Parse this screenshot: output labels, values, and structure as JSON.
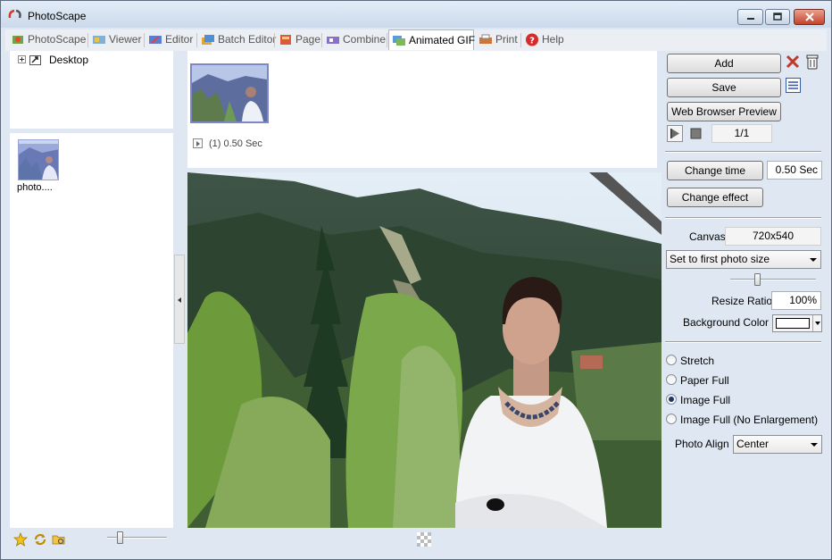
{
  "window": {
    "title": "PhotoScape"
  },
  "tabs": [
    {
      "label": "PhotoScape",
      "icon": "photoscape-icon",
      "active": false
    },
    {
      "label": "Viewer",
      "icon": "viewer-icon",
      "active": false
    },
    {
      "label": "Editor",
      "icon": "editor-icon",
      "active": false
    },
    {
      "label": "Batch Editor",
      "icon": "batch-editor-icon",
      "active": false
    },
    {
      "label": "Page",
      "icon": "page-icon",
      "active": false
    },
    {
      "label": "Combine",
      "icon": "combine-icon",
      "active": false
    },
    {
      "label": "Animated GIF",
      "icon": "animated-gif-icon",
      "active": true
    },
    {
      "label": "Print",
      "icon": "print-icon",
      "active": false
    },
    {
      "label": "Help",
      "icon": "help-icon",
      "active": false
    }
  ],
  "folder_tree": {
    "root_label": "Desktop"
  },
  "file_list": {
    "items": [
      {
        "name": "photo...."
      }
    ]
  },
  "frames": [
    {
      "info": "(1) 0.50 Sec"
    }
  ],
  "controls": {
    "add_label": "Add",
    "save_label": "Save",
    "web_preview_label": "Web Browser Preview",
    "frame_counter": "1/1",
    "change_time_label": "Change time",
    "time_value": "0.50 Sec",
    "change_effect_label": "Change effect",
    "canvas_label": "Canvas",
    "canvas_size": "720x540",
    "size_mode": "Set to first photo size",
    "resize_ratio_label": "Resize Ratio",
    "resize_ratio_value": "100%",
    "background_color_label": "Background Color",
    "background_color": "#ffffff",
    "fit_options": [
      {
        "label": "Stretch",
        "checked": false
      },
      {
        "label": "Paper Full",
        "checked": false
      },
      {
        "label": "Image Full",
        "checked": true
      },
      {
        "label": "Image Full (No Enlargement)",
        "checked": false
      }
    ],
    "photo_align_label": "Photo Align",
    "photo_align_value": "Center"
  },
  "colors": {
    "accent": "#4a5fb0",
    "selected_thumb": "#7c87c6"
  }
}
